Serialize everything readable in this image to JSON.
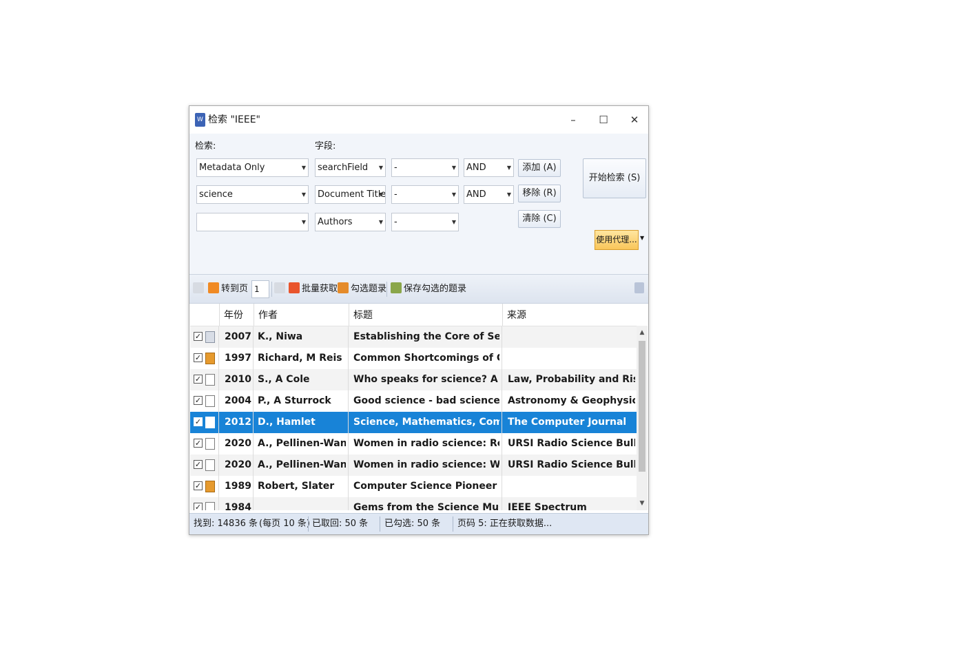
{
  "window": {
    "title": "检索 \"IEEE\"",
    "app_icon_text": "W",
    "min_glyph": "–",
    "max_glyph": "☐",
    "close_glyph": "✕"
  },
  "search": {
    "label_search": "检索:",
    "label_field": "字段:",
    "rows": [
      {
        "scope": "Metadata Only",
        "field": "searchField",
        "term": "-",
        "op": "AND"
      },
      {
        "scope": "science",
        "field": "Document Title",
        "term": "-",
        "op": "AND"
      },
      {
        "scope": "",
        "field": "Authors",
        "term": "-"
      }
    ],
    "add_label": "添加 (A)",
    "remove_label": "移除 (R)",
    "clear_label": "清除 (C)",
    "start_label": "开始检索 (S)",
    "proxy_label": "使用代理..."
  },
  "toolbar": {
    "goto_label": "转到页",
    "page_value": "1",
    "batch_label": "批量获取",
    "check_label": "勾选题录",
    "save_label": "保存勾选的题录"
  },
  "colors": {
    "selection": "#1883d7",
    "proxy_button": "#f9c65a"
  },
  "table": {
    "headers": {
      "year": "年份",
      "author": "作者",
      "title": "标题",
      "source": "来源"
    },
    "rows": [
      {
        "checked": true,
        "icon": "folder-icon",
        "year": "2007",
        "author": "K., Niwa",
        "title": "Establishing the Core of Service S",
        "source": ""
      },
      {
        "checked": true,
        "icon": "book-icon",
        "year": "1997",
        "author": "Richard, M Reis",
        "title": "Common Shortcomings of Grant .",
        "source": ""
      },
      {
        "checked": true,
        "icon": "document-icon",
        "year": "2010",
        "author": "S., A Cole",
        "title": "Who speaks for science? A respor",
        "source": "Law, Probability and Risk"
      },
      {
        "checked": true,
        "icon": "document-icon",
        "year": "2004",
        "author": "P., A Sturrock",
        "title": "Good science - bad science",
        "source": "Astronomy & Geophysics"
      },
      {
        "checked": true,
        "icon": "document-icon",
        "year": "2012",
        "author": "D., Hamlet",
        "title": "Science, Mathematics, Computer",
        "source": "The Computer Journal",
        "selected": true
      },
      {
        "checked": true,
        "icon": "document-icon",
        "year": "2020",
        "author": "A., Pellinen-Wannbe",
        "title": "Women in radio science: Reflectic",
        "source": "URSI Radio Science Bulletin"
      },
      {
        "checked": true,
        "icon": "document-icon",
        "year": "2020",
        "author": "A., Pellinen-Wannbe",
        "title": "Women in radio science: Women",
        "source": "URSI Radio Science Bulletin"
      },
      {
        "checked": true,
        "icon": "book-icon",
        "year": "1989",
        "author": "Robert, Slater",
        "title": "Computer Science Pioneer",
        "source": ""
      },
      {
        "checked": true,
        "icon": "document-icon",
        "year": "1984",
        "author": "",
        "title": "Gems from the Science Museum:",
        "source": "IEEE Spectrum"
      }
    ]
  },
  "status": {
    "found": "找到: 14836 条",
    "per_page": "(每页 10 条)",
    "fetched": "已取回: 50 条",
    "checked": "已勾选: 50 条",
    "page_status": "页码 5: 正在获取数据..."
  }
}
